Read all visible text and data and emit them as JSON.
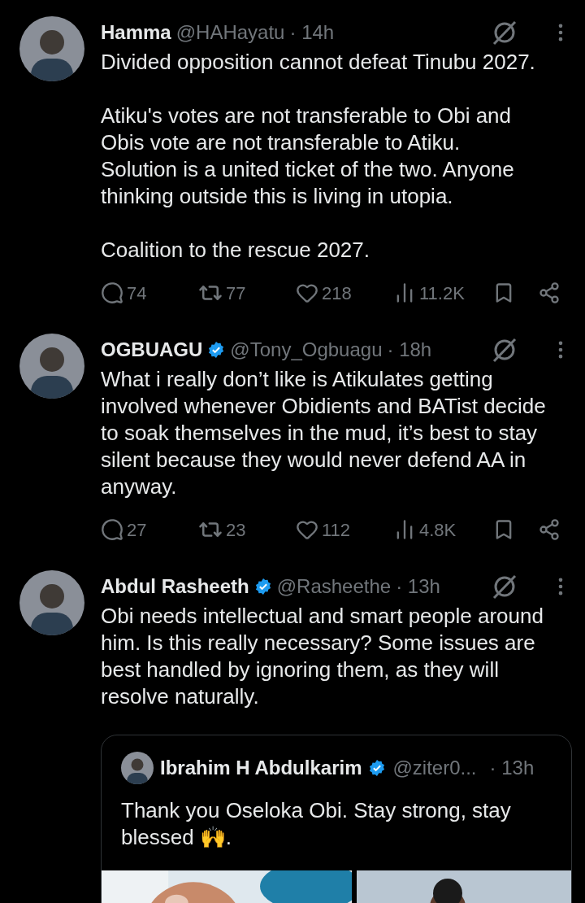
{
  "tweets": [
    {
      "name": "Hamma",
      "verified": false,
      "handle": "@HAHayatu",
      "time": "· 14h",
      "paragraphs": [
        "Divided opposition cannot defeat Tinubu 2027.",
        "Atiku's votes are not transferable to Obi and Obis vote are not transferable to Atiku.\nSolution is a united ticket of the two. Anyone thinking outside this is living in utopia.",
        "Coalition to the rescue 2027."
      ],
      "replies": "74",
      "reposts": "77",
      "likes": "218",
      "views": "11.2K"
    },
    {
      "name": "OGBUAGU",
      "verified": true,
      "handle": "@Tony_Ogbuagu",
      "time": "· 18h",
      "paragraphs": [
        "What i really don’t like is Atikulates getting involved whenever Obidients and BATist decide to soak themselves in the mud, it’s best to stay silent because they would never defend AA in anyway."
      ],
      "replies": "27",
      "reposts": "23",
      "likes": "112",
      "views": "4.8K"
    },
    {
      "name": "Abdul Rasheeth",
      "verified": true,
      "handle": "@Rasheethe",
      "time": "· 13h",
      "paragraphs": [
        "Obi needs intellectual and smart people around him. Is this really necessary? Some issues are best handled by ignoring them, as they will resolve naturally."
      ],
      "quote": {
        "name": "Ibrahim H Abdulkarim",
        "verified": true,
        "handle": "@ziter0...",
        "time": "· 13h",
        "text": "Thank you Oseloka Obi. Stay strong,  stay blessed 🙌."
      }
    }
  ]
}
